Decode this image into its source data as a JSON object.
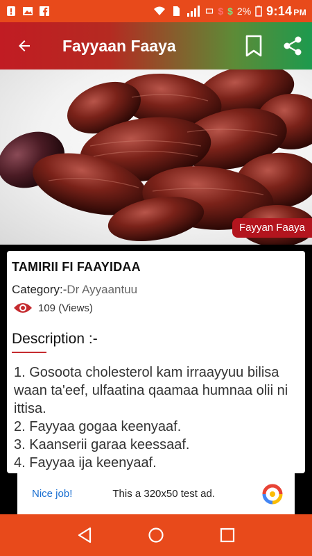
{
  "status_bar": {
    "battery_percent": "2%",
    "time": "9:14",
    "ampm": "PM"
  },
  "app_bar": {
    "title": "Fayyaan Faaya"
  },
  "hero": {
    "badge": "Fayyan Faaya"
  },
  "article": {
    "title": "TAMIRII FI FAAYIDAA",
    "category_label": "Category:-",
    "category_value": "Dr Ayyaantuu",
    "views": "109 (Views)",
    "description_label": "Description :-",
    "description_lines": [
      "1. Gosoota cholesterol kam irraayyuu bilisa waan ta'eef, ulfaatina qaamaa humnaa olii ni ittisa.",
      "2. Fayyaa gogaa keenyaaf.",
      "3. Kaanserii garaa keessaaf.",
      "4. Fayyaa ija keenyaaf."
    ]
  },
  "ad": {
    "nice": "Nice job!",
    "text": "This a 320x50 test ad."
  },
  "colors": {
    "status_bar": "#e84a1b",
    "appbar_left": "#c11c23",
    "appbar_right": "#1d9a4e",
    "accent_red": "#b3151e"
  },
  "icons": {
    "back": "arrow-left-icon",
    "bookmark": "bookmark-icon",
    "share": "share-icon",
    "views": "eye-icon"
  }
}
